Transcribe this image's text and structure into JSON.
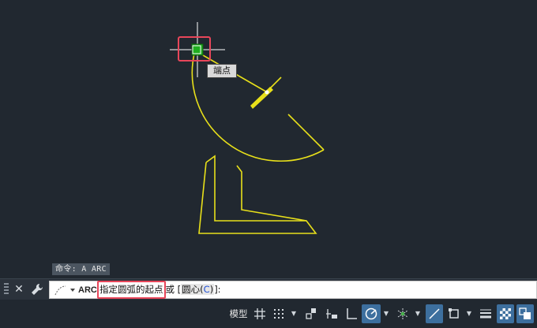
{
  "tooltip": {
    "label": "端点"
  },
  "command_history": {
    "text": "命令: A ARC"
  },
  "command_line": {
    "command_name": "ARC",
    "prompt_highlight": "指定圆弧的起点",
    "prompt_or": "或 [",
    "option_label": "圆心(",
    "option_key": "C",
    "option_close": ")",
    "prompt_end": "]:"
  },
  "status_bar": {
    "model_label": "模型",
    "icons": [
      "grid-icon",
      "snap-grid-icon",
      "infer-constraints-icon",
      "dynamic-input-icon",
      "ortho-icon",
      "polar-tracking-icon",
      "isometric-icon",
      "object-snap-tracking-icon",
      "object-snap-icon",
      "lineweight-icon",
      "transparency-icon",
      "selection-cycling-icon"
    ]
  },
  "colors": {
    "background": "#212830",
    "drawing": "#e8e01a",
    "highlight": "#e8465a",
    "snap_marker": "#1fae1f",
    "active_toggle": "#3d6f9e"
  }
}
